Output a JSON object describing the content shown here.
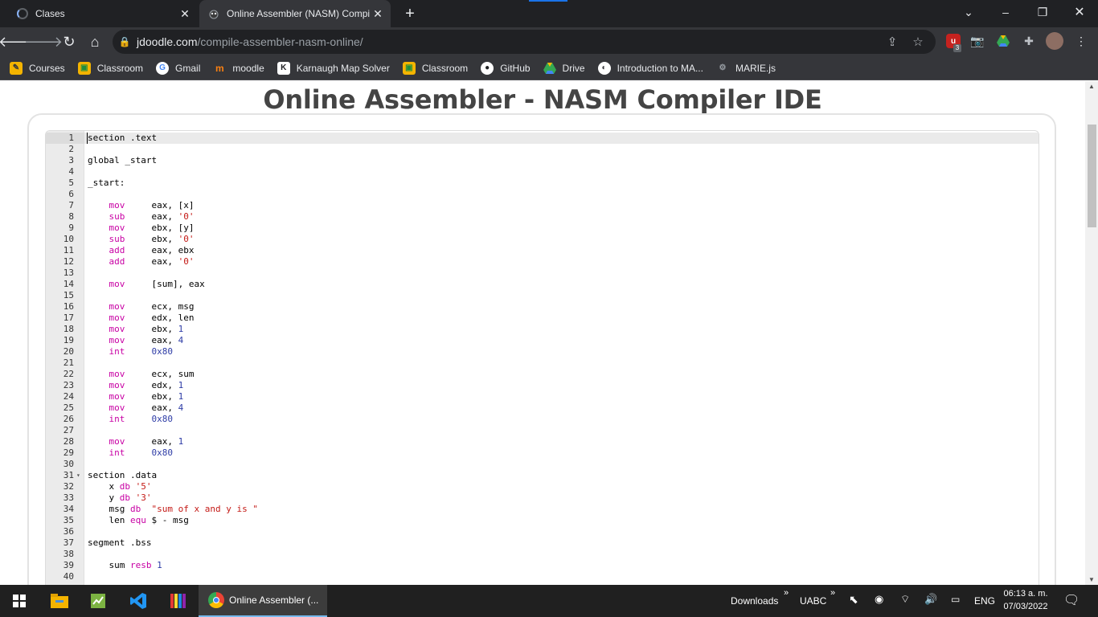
{
  "browser": {
    "tabs": [
      {
        "title": "Clases",
        "active": false
      },
      {
        "title": "Online Assembler (NASM) Compi",
        "active": true
      }
    ],
    "url_host": "jdoodle.com",
    "url_path": "/compile-assembler-nasm-online/",
    "extension_badge": "3",
    "bookmarks": [
      {
        "label": "Courses",
        "icon": "courses-icon",
        "color": "#f4b400"
      },
      {
        "label": "Classroom",
        "icon": "classroom-icon",
        "color": "#f4b400"
      },
      {
        "label": "Gmail",
        "icon": "google-icon",
        "color": "#ffffff"
      },
      {
        "label": "moodle",
        "icon": "moodle-icon",
        "color": "#f98012"
      },
      {
        "label": "Karnaugh Map Solver",
        "icon": "karnaugh-icon",
        "color": "#ffffff"
      },
      {
        "label": "Classroom",
        "icon": "classroom-icon",
        "color": "#f4b400"
      },
      {
        "label": "GitHub",
        "icon": "github-icon",
        "color": "#ffffff"
      },
      {
        "label": "Drive",
        "icon": "drive-icon",
        "color": "#34a853"
      },
      {
        "label": "Introduction to MA...",
        "icon": "globe-icon",
        "color": "#ffffff"
      },
      {
        "label": "MARIE.js",
        "icon": "marie-icon",
        "color": "#9aa0a6"
      }
    ]
  },
  "page": {
    "title": "Online Assembler - NASM Compiler IDE"
  },
  "editor": {
    "lines": [
      [
        [
          "",
          "section .text"
        ]
      ],
      [],
      [
        [
          "",
          "global _start"
        ]
      ],
      [],
      [
        [
          "",
          "_start:"
        ]
      ],
      [],
      [
        [
          "",
          "    "
        ],
        [
          "kw",
          "mov"
        ],
        [
          "",
          "     eax, [x]"
        ]
      ],
      [
        [
          "",
          "    "
        ],
        [
          "kw",
          "sub"
        ],
        [
          "",
          "     eax, "
        ],
        [
          "str",
          "'0'"
        ]
      ],
      [
        [
          "",
          "    "
        ],
        [
          "kw",
          "mov"
        ],
        [
          "",
          "     ebx, [y]"
        ]
      ],
      [
        [
          "",
          "    "
        ],
        [
          "kw",
          "sub"
        ],
        [
          "",
          "     ebx, "
        ],
        [
          "str",
          "'0'"
        ]
      ],
      [
        [
          "",
          "    "
        ],
        [
          "kw",
          "add"
        ],
        [
          "",
          "     eax, ebx"
        ]
      ],
      [
        [
          "",
          "    "
        ],
        [
          "kw",
          "add"
        ],
        [
          "",
          "     eax, "
        ],
        [
          "str",
          "'0'"
        ]
      ],
      [],
      [
        [
          "",
          "    "
        ],
        [
          "kw",
          "mov"
        ],
        [
          "",
          "     [sum], eax"
        ]
      ],
      [],
      [
        [
          "",
          "    "
        ],
        [
          "kw",
          "mov"
        ],
        [
          "",
          "     ecx, msg"
        ]
      ],
      [
        [
          "",
          "    "
        ],
        [
          "kw",
          "mov"
        ],
        [
          "",
          "     edx, len"
        ]
      ],
      [
        [
          "",
          "    "
        ],
        [
          "kw",
          "mov"
        ],
        [
          "",
          "     ebx, "
        ],
        [
          "num",
          "1"
        ]
      ],
      [
        [
          "",
          "    "
        ],
        [
          "kw",
          "mov"
        ],
        [
          "",
          "     eax, "
        ],
        [
          "num",
          "4"
        ]
      ],
      [
        [
          "",
          "    "
        ],
        [
          "kw",
          "int"
        ],
        [
          "",
          "     "
        ],
        [
          "num",
          "0x80"
        ]
      ],
      [],
      [
        [
          "",
          "    "
        ],
        [
          "kw",
          "mov"
        ],
        [
          "",
          "     ecx, sum"
        ]
      ],
      [
        [
          "",
          "    "
        ],
        [
          "kw",
          "mov"
        ],
        [
          "",
          "     edx, "
        ],
        [
          "num",
          "1"
        ]
      ],
      [
        [
          "",
          "    "
        ],
        [
          "kw",
          "mov"
        ],
        [
          "",
          "     ebx, "
        ],
        [
          "num",
          "1"
        ]
      ],
      [
        [
          "",
          "    "
        ],
        [
          "kw",
          "mov"
        ],
        [
          "",
          "     eax, "
        ],
        [
          "num",
          "4"
        ]
      ],
      [
        [
          "",
          "    "
        ],
        [
          "kw",
          "int"
        ],
        [
          "",
          "     "
        ],
        [
          "num",
          "0x80"
        ]
      ],
      [],
      [
        [
          "",
          "    "
        ],
        [
          "kw",
          "mov"
        ],
        [
          "",
          "     eax, "
        ],
        [
          "num",
          "1"
        ]
      ],
      [
        [
          "",
          "    "
        ],
        [
          "kw",
          "int"
        ],
        [
          "",
          "     "
        ],
        [
          "num",
          "0x80"
        ]
      ],
      [],
      [
        [
          "",
          "section .data"
        ]
      ],
      [
        [
          "",
          "    x "
        ],
        [
          "kw",
          "db"
        ],
        [
          "",
          " "
        ],
        [
          "str",
          "'5'"
        ]
      ],
      [
        [
          "",
          "    y "
        ],
        [
          "kw",
          "db"
        ],
        [
          "",
          " "
        ],
        [
          "str",
          "'3'"
        ]
      ],
      [
        [
          "",
          "    msg "
        ],
        [
          "kw",
          "db"
        ],
        [
          "",
          "  "
        ],
        [
          "str",
          "\"sum of x and y is \""
        ]
      ],
      [
        [
          "",
          "    len "
        ],
        [
          "kw",
          "equ"
        ],
        [
          "",
          " $ - msg"
        ]
      ],
      [],
      [
        [
          "",
          "segment .bss"
        ]
      ],
      [],
      [
        [
          "",
          "    sum "
        ],
        [
          "kw",
          "resb"
        ],
        [
          "",
          " "
        ],
        [
          "num",
          "1"
        ]
      ],
      []
    ]
  },
  "taskbar": {
    "active_app": "Online Assembler (...",
    "toolbar_downloads": "Downloads",
    "toolbar_uabc": "UABC",
    "language": "ENG",
    "time": "06:13 a. m.",
    "date": "07/03/2022"
  }
}
